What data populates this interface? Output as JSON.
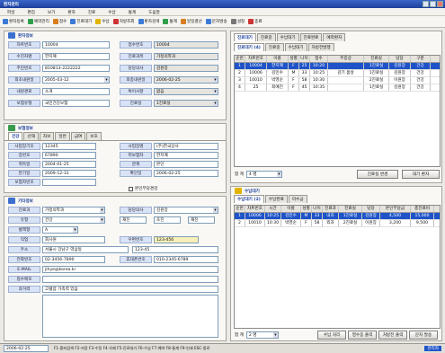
{
  "window": {
    "title": "환자관리",
    "controls": [
      "_",
      "□",
      "X"
    ]
  },
  "menu": [
    "파일",
    "편집",
    "보기",
    "환자",
    "진료",
    "수납",
    "통계",
    "도움말"
  ],
  "toolbar": [
    {
      "label": "환자등록",
      "icon": "user-add-icon",
      "color": "#3b7bd6"
    },
    {
      "label": "예약관리",
      "icon": "calendar-icon",
      "color": "#2f9e4a"
    },
    {
      "label": "접수",
      "icon": "clipboard-icon",
      "color": "#d97e1f"
    },
    {
      "label": "진료대기",
      "icon": "list-icon",
      "color": "#3b7bd6"
    },
    {
      "label": "수납",
      "icon": "money-icon",
      "color": "#e2b400"
    },
    {
      "label": "처방조회",
      "icon": "pill-icon",
      "color": "#c33"
    },
    {
      "label": "환자검색",
      "icon": "search-icon",
      "color": "#3b7bd6"
    },
    {
      "label": "통계",
      "icon": "chart-icon",
      "color": "#2f9e4a"
    },
    {
      "label": "일일결산",
      "icon": "calc-icon",
      "color": "#d97e1f"
    },
    {
      "label": "문자발송",
      "icon": "mail-icon",
      "color": "#3b7bd6"
    },
    {
      "label": "설정",
      "icon": "gear-icon",
      "color": "#777"
    },
    {
      "label": "종료",
      "icon": "exit-icon",
      "color": "#c33"
    }
  ],
  "patient_section": {
    "title": "환자정보",
    "rows": [
      {
        "l1": "차트번호",
        "v1": "10004",
        "l2": "접수번호",
        "v2": "10004"
      },
      {
        "l1": "수진자명",
        "v1": "한지혜",
        "l2": "진료과목",
        "v2": "가정의학과"
      },
      {
        "l1": "주민번호",
        "v1": "810813-2222222",
        "l2": "담당의사",
        "v2": "김원장"
      },
      {
        "l1": "최초내원일",
        "v1": "2005-03-12",
        "l2": "최종내원일",
        "v2": "2006-02-25"
      },
      {
        "l1": "내원경로",
        "v1": "소개",
        "l2": "특이사항",
        "v2": "없음"
      },
      {
        "l1": "보험유형",
        "v1": "국민건강보험",
        "l2": "진료실",
        "v2": "1진료실"
      }
    ]
  },
  "insurance_section": {
    "title": "보험정보",
    "tabs": [
      "건강",
      "산재",
      "자보",
      "일반",
      "급여",
      "보호"
    ],
    "rows": [
      {
        "l1": "사업장기호",
        "v1": "12345",
        "l2": "사업장명",
        "v2": "(주)한국상사"
      },
      {
        "l1": "증번호",
        "v1": "67890",
        "l2": "피보험자",
        "v2": "한지혜"
      },
      {
        "l1": "취득일",
        "v1": "2004-01-25",
        "l2": "관계",
        "v2": "본인"
      },
      {
        "l1": "만기일",
        "v1": "2009-12-31",
        "l2": "확인일",
        "v2": "2006-02-25"
      },
      {
        "l1": "보험자번호",
        "v1": "",
        "l2": "",
        "v2": ""
      }
    ],
    "check": "본인부담경감"
  },
  "contact_section": {
    "title": "기타정보",
    "r1": {
      "l1": "진료과",
      "v1": "가정의학과",
      "l2": "담당의사",
      "v2": "김원장"
    },
    "r2": {
      "l1": "유형",
      "v1": "건강",
      "l2": "",
      "v2": ""
    },
    "checks": [
      "재진",
      "초진",
      "재진"
    ],
    "r3": {
      "l1": "혈액형",
      "v1": "A"
    },
    "r4": {
      "l1": "직업",
      "v1": "회사원",
      "l2": "우편번호",
      "v2": "123-456"
    },
    "addr1": {
      "l": "주소",
      "v1": "서울시 강남구 역삼동",
      "v2": "123-45"
    },
    "phone": {
      "l1": "전화번호",
      "v1": "02-3456-7890",
      "l2": "휴대폰번호",
      "v2": "010-2345-6789"
    },
    "email": {
      "l": "E-MAIL",
      "v": "jihye@korea.kr"
    },
    "memo1": {
      "l": "접수메모",
      "v": ""
    },
    "memo2": {
      "l": "과거력",
      "v": "고혈압 가족력 있음"
    }
  },
  "waiting": {
    "title": "진료대기",
    "tabs": [
      "진료대기",
      "진료중",
      "수납대기",
      "진료완료",
      "예약환자"
    ],
    "subtabs": [
      "진료대기 (4)",
      "진료중",
      "수납대기",
      "처방전발행"
    ],
    "columns": [
      "순번",
      "차트번호",
      "이름",
      "성별",
      "나이",
      "접수",
      "주증상",
      "진료실",
      "담당",
      "구분"
    ],
    "rows": [
      [
        "1",
        "10004",
        "한지혜",
        "F",
        "25",
        "10:20",
        "",
        "1진료실",
        "김원장",
        "건강"
      ],
      [
        "2",
        "10006",
        "김민수",
        "M",
        "33",
        "10:25",
        "감기 몸살",
        "1진료실",
        "김원장",
        "건강"
      ],
      [
        "3",
        "10010",
        "박영순",
        "F",
        "58",
        "10:30",
        "",
        "2진료실",
        "이원장",
        "건강"
      ],
      [
        "4",
        "25",
        "최예진",
        "F",
        "45",
        "10:35",
        "",
        "1진료실",
        "김원장",
        "건강"
      ]
    ],
    "total_label": "합 계",
    "total_value": "4 명",
    "btn1": "진료실 변경",
    "btn2": "대기 환자"
  },
  "payment": {
    "title": "수납대기",
    "tabs": [
      "수납대기 (2)",
      "수납완료",
      "미수금"
    ],
    "columns": [
      "순번",
      "차트번호",
      "시간",
      "이름",
      "성별",
      "나이",
      "진료과",
      "진료실",
      "담당",
      "본인부담금",
      "총진료비"
    ],
    "rows": [
      [
        "1",
        "10006",
        "10:25",
        "김민수",
        "M",
        "33",
        "내과",
        "1진료실",
        "김원장",
        "4,500",
        "15,000"
      ],
      [
        "2",
        "10010",
        "10:30",
        "박영순",
        "F",
        "58",
        "외과",
        "2진료실",
        "이원장",
        "3,200",
        "9,500"
      ]
    ],
    "total_label": "합 계",
    "total_value": "2 명",
    "btns": [
      "수납 처리",
      "영수증 출력",
      "처방전 출력",
      "문자 발송"
    ]
  },
  "status": {
    "date": "2006-02-25",
    "keys": "F1-환자검색  F2-저장  F3-수정  F4-삭제  F5-진료대기  F6-수납  F7-예약  F8-통계  F9-인쇄  ESC-종료",
    "user": "관리자"
  }
}
